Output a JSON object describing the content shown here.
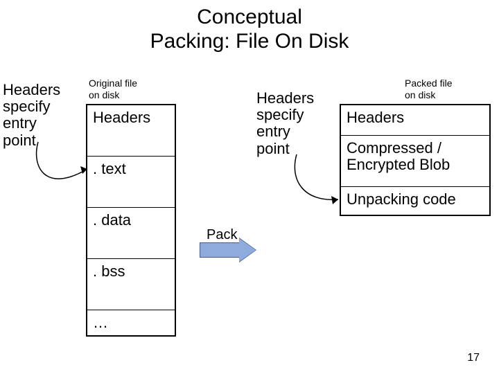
{
  "title_line1": "Conceptual",
  "title_line2": "Packing: File On Disk",
  "original": {
    "caption_l1": "Original file",
    "caption_l2": "on disk",
    "segments": [
      "Headers",
      ". text",
      ". data",
      ". bss",
      "…"
    ]
  },
  "packed": {
    "caption_l1": "Packed file",
    "caption_l2": "on disk",
    "seg_headers": "Headers",
    "seg_blob_l1": "Compressed /",
    "seg_blob_l2": "Encrypted Blob",
    "seg_unpack": "Unpacking code"
  },
  "annot_left_l1": "Headers",
  "annot_left_l2": "specify",
  "annot_left_l3": "entry",
  "annot_left_l4": "point",
  "annot_right_l1": "Headers",
  "annot_right_l2": "specify",
  "annot_right_l3": "entry",
  "annot_right_l4": "point",
  "pack_label": "Pack",
  "page_number": "17"
}
